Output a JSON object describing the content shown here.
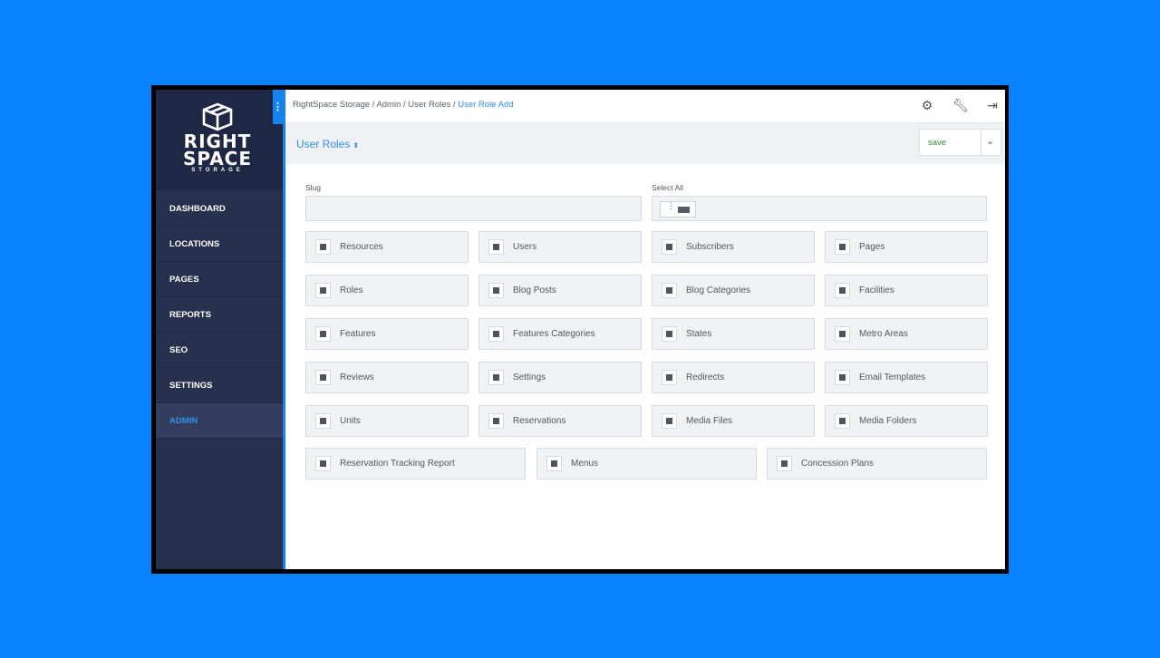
{
  "brand": {
    "line1": "RIGHT",
    "line2": "SPACE",
    "line3": "STORAGE"
  },
  "sidebar": {
    "items": [
      {
        "label": "DASHBOARD"
      },
      {
        "label": "LOCATIONS"
      },
      {
        "label": "PAGES"
      },
      {
        "label": "REPORTS"
      },
      {
        "label": "SEO"
      },
      {
        "label": "SETTINGS"
      },
      {
        "label": "ADMIN",
        "active": true
      }
    ]
  },
  "breadcrumb": {
    "items": [
      "RightSpace Storage",
      "Admin",
      "User Roles"
    ],
    "current": "User Role Add",
    "separator": " / "
  },
  "header": {
    "title": "User Roles",
    "sort_glyph": "⬍"
  },
  "save_select": {
    "value": "save"
  },
  "form": {
    "slug_label": "Slug",
    "slug_value": "",
    "select_all_label": "Select All",
    "permissions": [
      "Resources",
      "Users",
      "Subscribers",
      "Pages",
      "Roles",
      "Blog Posts",
      "Blog Categories",
      "Facilities",
      "Features",
      "Features Categories",
      "States",
      "Metro Areas",
      "Reviews",
      "Settings",
      "Redirects",
      "Email Templates",
      "Units",
      "Reservations",
      "Media Files",
      "Media Folders",
      "Reservation Tracking Report",
      "Menus",
      "Concession Plans"
    ]
  },
  "icons": {
    "settings": "gear-icon",
    "tools": "wrench-icon",
    "logout": "logout-icon",
    "handle": "vertical-dots-icon"
  },
  "colors": {
    "accent": "#2f8ee8",
    "sidebar": "#27304d",
    "background": "#0a84fe"
  }
}
